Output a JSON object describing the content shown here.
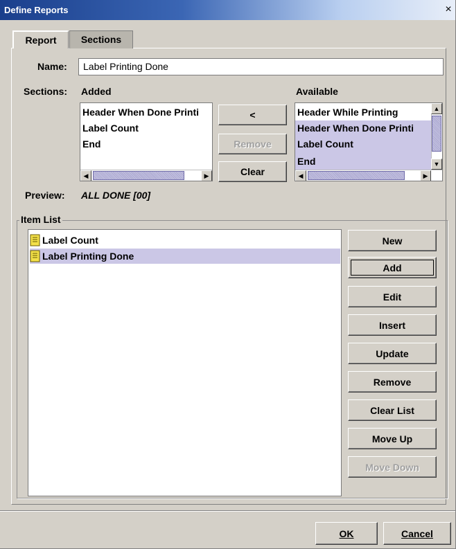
{
  "window": {
    "title": "Define Reports",
    "close_glyph": "×"
  },
  "tabs": [
    {
      "label": "Report",
      "active": true
    },
    {
      "label": "Sections",
      "active": false
    }
  ],
  "name_field": {
    "label": "Name:",
    "value": "Label Printing Done"
  },
  "sections": {
    "label": "Sections:",
    "added": {
      "header": "Added",
      "items": [
        "Header When Done Printi",
        "Label Count",
        "End"
      ]
    },
    "available": {
      "header": "Available",
      "items": [
        "Header While Printing",
        "Header When Done Printi",
        "Label Count",
        "End"
      ],
      "selected": [
        "Header When Done Printi",
        "Label Count",
        "End"
      ]
    },
    "buttons": {
      "move_left": "<",
      "remove": "Remove",
      "clear": "Clear"
    }
  },
  "preview": {
    "label": "Preview:",
    "value": "ALL DONE [00]"
  },
  "item_list": {
    "title": "Item List",
    "items": [
      {
        "label": "Label Count",
        "icon": "document-icon",
        "selected": false
      },
      {
        "label": "Label Printing Done",
        "icon": "document-icon",
        "selected": true
      }
    ]
  },
  "item_buttons": {
    "new": "New",
    "add": "Add",
    "edit": "Edit",
    "insert": "Insert",
    "update": "Update",
    "remove": "Remove",
    "clear_list": "Clear List",
    "move_up": "Move Up",
    "move_down": "Move Down"
  },
  "footer": {
    "ok": "OK",
    "cancel": "Cancel"
  },
  "colors": {
    "selection": "#cbc7e6",
    "titlebar": "#1a3f8c",
    "dialog_bg": "#d4d0c8"
  }
}
